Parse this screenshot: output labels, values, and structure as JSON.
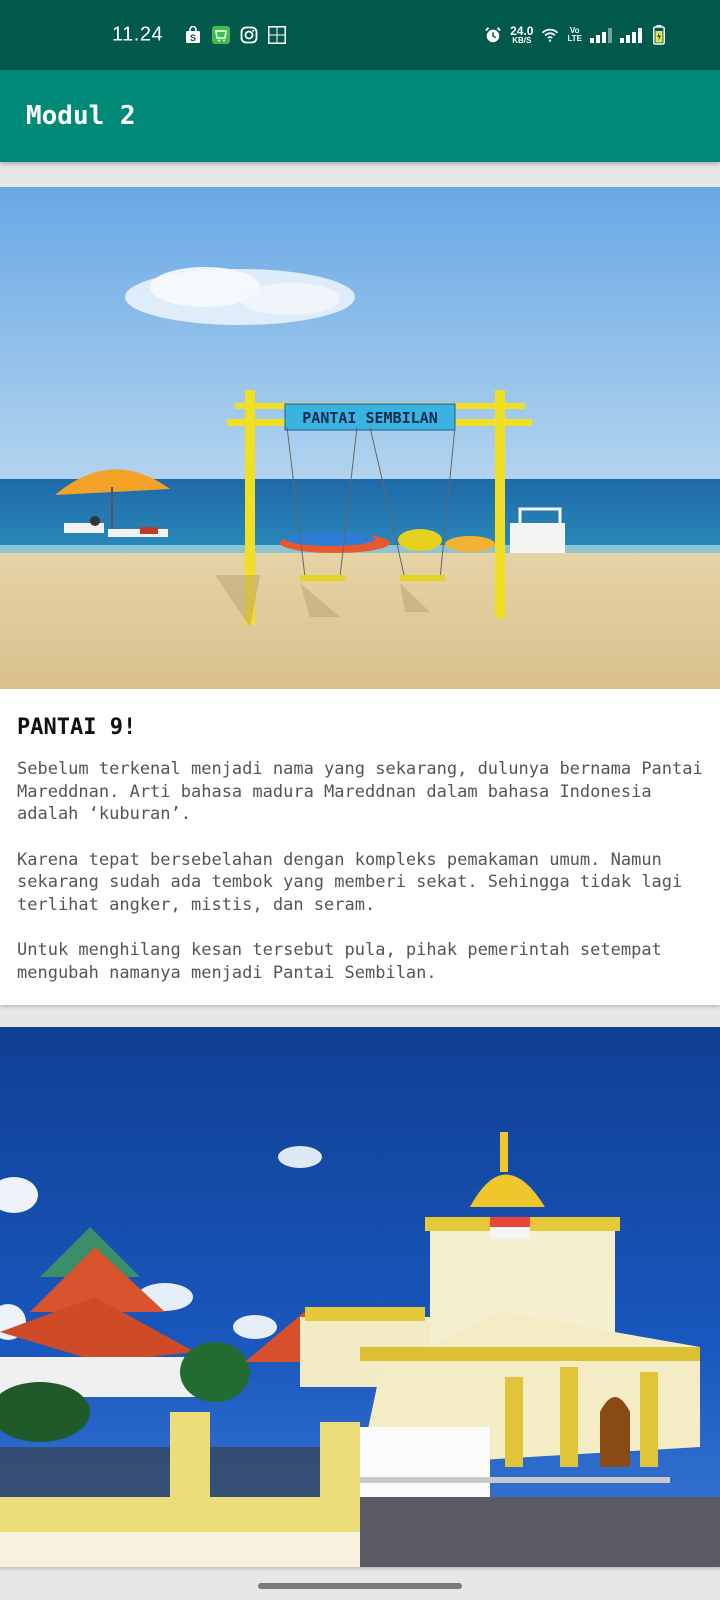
{
  "status_bar": {
    "time": "11.24",
    "left_icons": [
      "shopping-bag-icon",
      "store-icon",
      "instagram-icon",
      "uniqlo-icon"
    ],
    "net_speed_value": "24.0",
    "net_speed_unit": "KB/S",
    "volte_top": "Vo",
    "volte_bottom": "LTE"
  },
  "app_bar": {
    "title": "Modul 2"
  },
  "cards": [
    {
      "image_sign": "PANTAI SEMBILAN",
      "title": "PANTAI 9!",
      "paragraphs": [
        "Sebelum terkenal menjadi nama yang sekarang, dulunya bernama Pantai Mareddnan. Arti bahasa madura Mareddnan dalam bahasa Indonesia adalah ‘kuburan’.",
        "Karena tepat bersebelahan dengan kompleks pemakaman umum. Namun sekarang sudah ada tembok yang memberi sekat. Sehingga tidak lagi terlihat angker, mistis, dan seram.",
        "Untuk menghilang kesan tersebut pula, pihak pemerintah setempat mengubah namanya menjadi Pantai Sembilan."
      ]
    },
    {
      "image_description_icon": "mosque-photo"
    }
  ],
  "colors": {
    "status_bar": "#00594a",
    "app_bar": "#018977",
    "background": "#e7e7e7"
  }
}
